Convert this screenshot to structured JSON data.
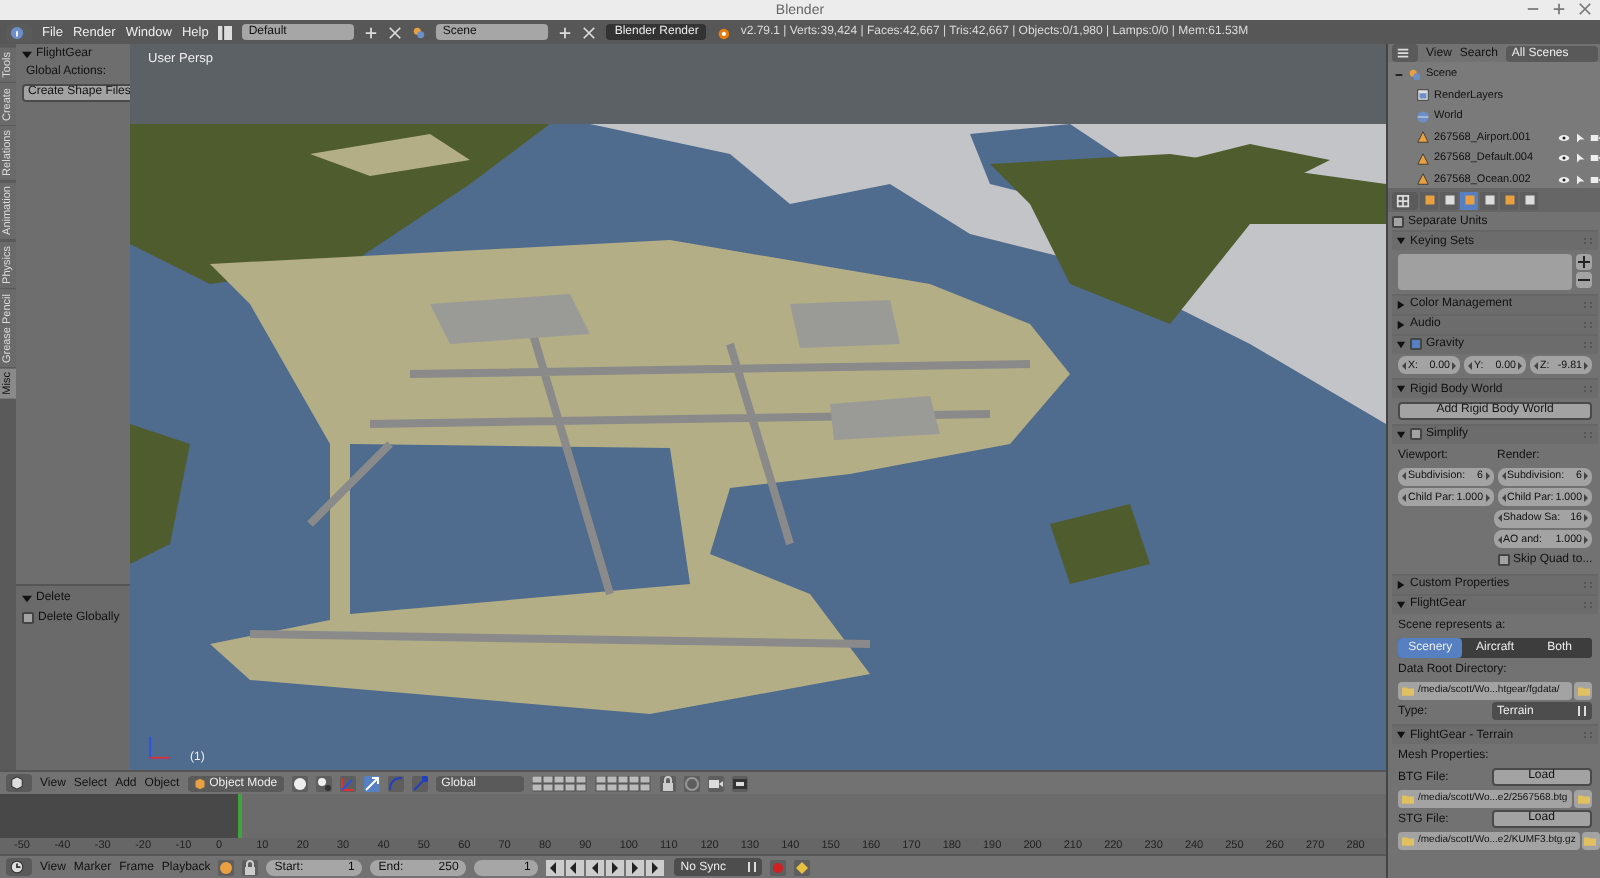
{
  "window": {
    "title": "Blender"
  },
  "info_header": {
    "menus": [
      "File",
      "Render",
      "Window",
      "Help"
    ],
    "screen_layout": "Default",
    "scene": "Scene",
    "render_engine": "Blender Render",
    "stats": "v2.79.1 | Verts:39,424 | Faces:42,667 | Tris:42,667 | Objects:0/1,980 | Lamps:0/0 | Mem:61.53M"
  },
  "tool_shelf": {
    "tabs": [
      {
        "label": "Tools",
        "selected": false
      },
      {
        "label": "Create",
        "selected": false
      },
      {
        "label": "Relations",
        "selected": false
      },
      {
        "label": "Animation",
        "selected": false
      },
      {
        "label": "Physics",
        "selected": false
      },
      {
        "label": "Grease Pencil",
        "selected": false
      },
      {
        "label": "Misc",
        "selected": true
      }
    ],
    "panel": {
      "title": "FlightGear",
      "subtitle": "Global Actions:",
      "button": "Create Shape Files"
    },
    "operator_panel": {
      "title": "Delete",
      "checkbox_label": "Delete Globally",
      "checked": false
    }
  },
  "viewport": {
    "view_label": "User Persp",
    "frame_label": "(1)"
  },
  "view3d_header": {
    "menus": [
      "View",
      "Select",
      "Add",
      "Object"
    ],
    "mode": "Object Mode",
    "orientation": "Global"
  },
  "timeline": {
    "ticks": [
      "-50",
      "-40",
      "-30",
      "-20",
      "-10",
      "0",
      "10",
      "20",
      "30",
      "40",
      "50",
      "60",
      "70",
      "80",
      "90",
      "100",
      "110",
      "120",
      "130",
      "140",
      "150",
      "160",
      "170",
      "180",
      "190",
      "200",
      "210",
      "220",
      "230",
      "240",
      "250",
      "260",
      "270",
      "280"
    ]
  },
  "timeline_header": {
    "menus": [
      "View",
      "Marker",
      "Frame",
      "Playback"
    ],
    "start_label": "Start:",
    "start": "1",
    "end_label": "End:",
    "end": "250",
    "current": "1",
    "sync": "No Sync"
  },
  "outliner": {
    "menus": [
      "View",
      "Search"
    ],
    "filter": "All Scenes",
    "tree": [
      {
        "label": "Scene",
        "expanded": true,
        "children": [
          {
            "label": "RenderLayers",
            "kind": "layers"
          },
          {
            "label": "World",
            "kind": "world"
          },
          {
            "label": "267568_Airport.001",
            "kind": "object"
          },
          {
            "label": "267568_Default.004",
            "kind": "object"
          },
          {
            "label": "267568_Ocean.002",
            "kind": "object"
          }
        ]
      }
    ]
  },
  "properties": {
    "tabs": [
      {
        "selected": false
      },
      {
        "selected": false
      },
      {
        "selected": true
      },
      {
        "selected": false
      },
      {
        "selected": false
      },
      {
        "selected": false
      }
    ],
    "top_rows": [
      [
        {
          "kind": "checkbox",
          "text": "Separate Units",
          "checked": false
        }
      ]
    ],
    "panels": [
      {
        "title": "Keying Sets",
        "expanded": true,
        "rows": [
          [
            {
              "kind": "listbox"
            }
          ]
        ]
      },
      {
        "title": "Color Management",
        "expanded": false
      },
      {
        "title": "Audio",
        "expanded": false
      },
      {
        "title": "Gravity",
        "expanded": true,
        "enabled": true,
        "rows": [
          [
            {
              "kind": "field",
              "label": "X:",
              "value": "0.00"
            },
            {
              "kind": "field",
              "label": "Y:",
              "value": "0.00"
            },
            {
              "kind": "field",
              "label": "Z:",
              "value": "-9.81"
            }
          ]
        ]
      },
      {
        "title": "Rigid Body World",
        "expanded": true,
        "rows": [
          [
            {
              "kind": "button",
              "text": "Add Rigid Body World"
            }
          ]
        ]
      },
      {
        "title": "Simplify",
        "expanded": true,
        "enabled": false,
        "rows": [
          [
            {
              "kind": "label",
              "text": "Viewport:"
            },
            {
              "kind": "label",
              "text": "Render:"
            }
          ],
          [
            {
              "kind": "field",
              "label": "Subdivision:",
              "value": "6"
            },
            {
              "kind": "field",
              "label": "Subdivision:",
              "value": "6"
            }
          ],
          [
            {
              "kind": "field",
              "label": "Child Par:",
              "value": "1.000"
            },
            {
              "kind": "field",
              "label": "Child Par:",
              "value": "1.000"
            }
          ],
          [
            {
              "kind": "spacer"
            },
            {
              "kind": "field",
              "label": "Shadow Sa:",
              "value": "16"
            }
          ],
          [
            {
              "kind": "spacer"
            },
            {
              "kind": "field",
              "label": "AO and:",
              "value": "1.000"
            }
          ],
          [
            {
              "kind": "spacer"
            },
            {
              "kind": "checkbox",
              "text": "Skip Quad to...",
              "checked": false
            }
          ]
        ]
      },
      {
        "title": "Custom Properties",
        "expanded": false
      },
      {
        "title": "FlightGear",
        "expanded": true,
        "rows": [
          [
            {
              "kind": "label",
              "text": "Scene represents a:"
            }
          ],
          [
            {
              "kind": "segmented",
              "options": [
                {
                  "label": "Scenery",
                  "selected": true
                },
                {
                  "label": "Aircraft",
                  "selected": false
                },
                {
                  "label": "Both",
                  "selected": false
                }
              ]
            }
          ],
          [
            {
              "kind": "label",
              "text": "Data Root Directory:"
            }
          ],
          [
            {
              "kind": "path",
              "value": "/media/scott/Wo...htgear/fgdata/"
            }
          ],
          [
            {
              "kind": "label",
              "text": "Type:"
            },
            {
              "kind": "dropdown",
              "value": "Terrain"
            }
          ]
        ]
      },
      {
        "title": "FlightGear - Terrain",
        "expanded": true,
        "rows": [
          [
            {
              "kind": "label",
              "text": "Mesh Properties:"
            }
          ],
          [
            {
              "kind": "label",
              "text": "BTG File:"
            },
            {
              "kind": "button",
              "text": "Load"
            }
          ],
          [
            {
              "kind": "path",
              "value": "/media/scott/Wo...e2/2567568.btg"
            }
          ],
          [
            {
              "kind": "label",
              "text": "STG File:"
            },
            {
              "kind": "button",
              "text": "Load"
            }
          ],
          [
            {
              "kind": "path",
              "value": "/media/scott/Wo...e2/KUMF3.btg.gz"
            }
          ]
        ]
      }
    ]
  }
}
